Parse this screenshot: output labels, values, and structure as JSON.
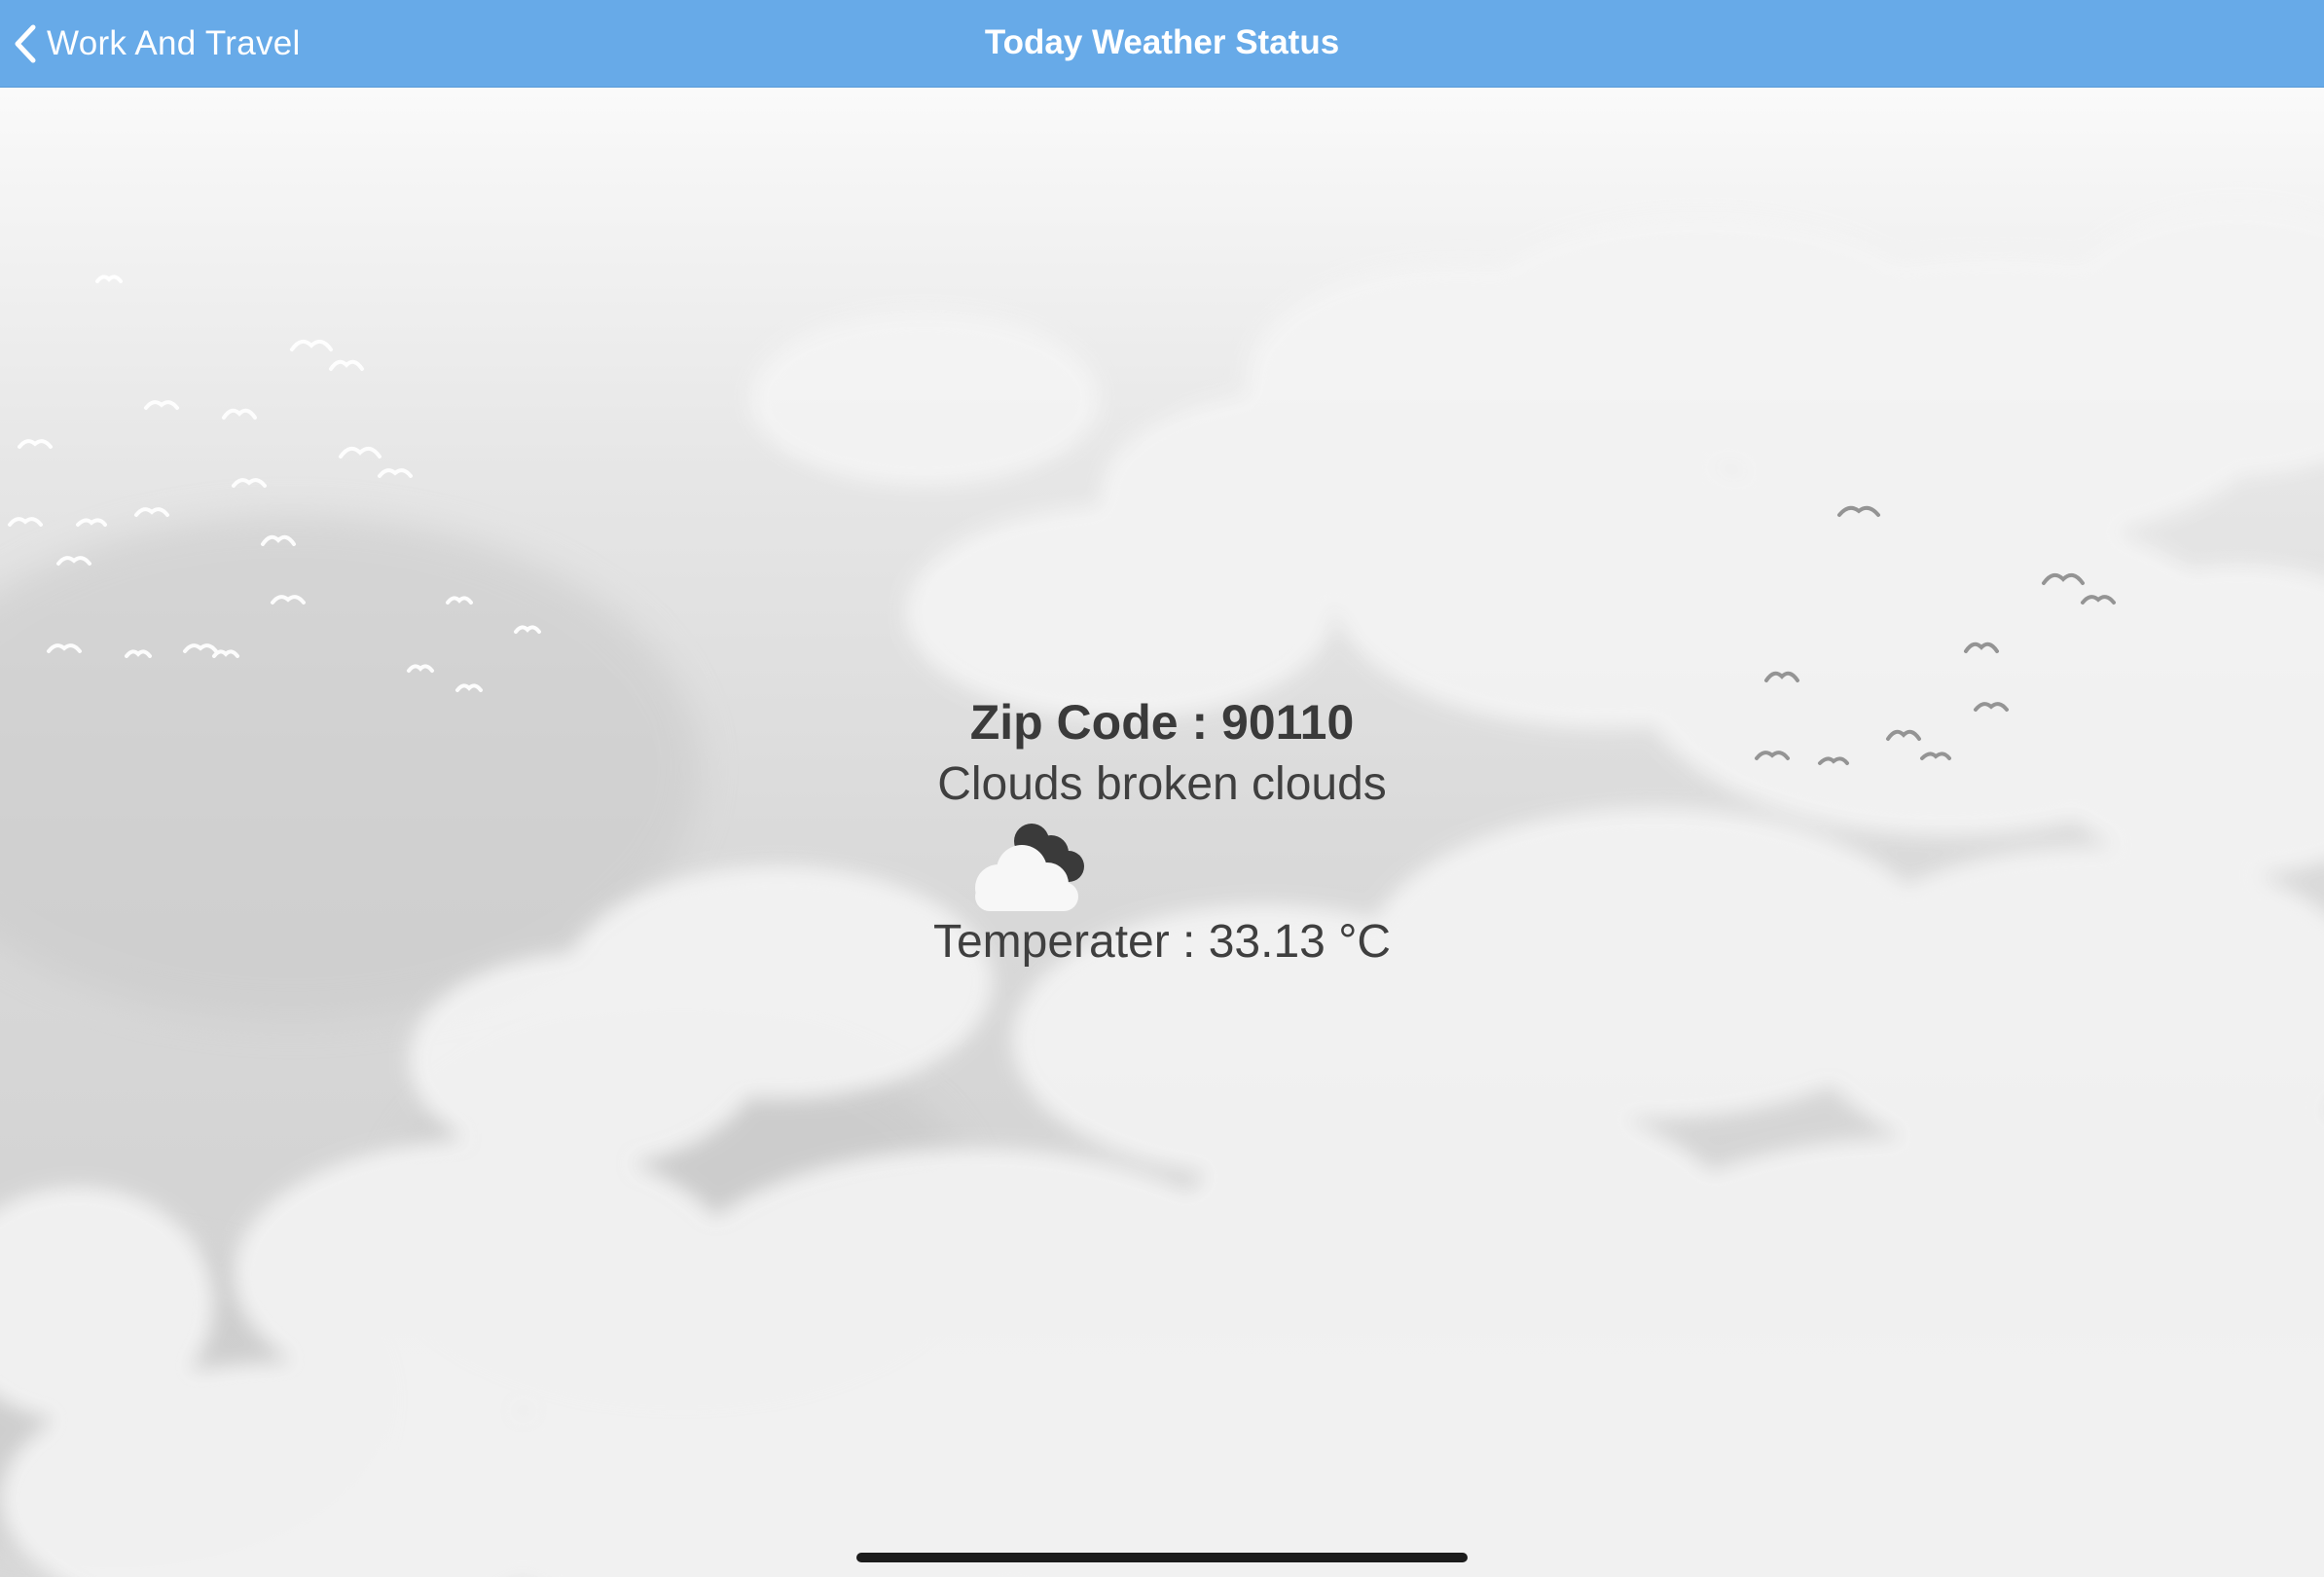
{
  "navbar": {
    "back_label": "Work And Travel",
    "title": "Today Weather Status",
    "color": "#67aae8"
  },
  "weather": {
    "zip_label": "Zip Code :",
    "zip_code": "90110",
    "condition": "Clouds broken clouds",
    "icon": "broken-clouds-icon",
    "temperature_label": "Temperater :",
    "temperature_value": "33.13 °C"
  }
}
